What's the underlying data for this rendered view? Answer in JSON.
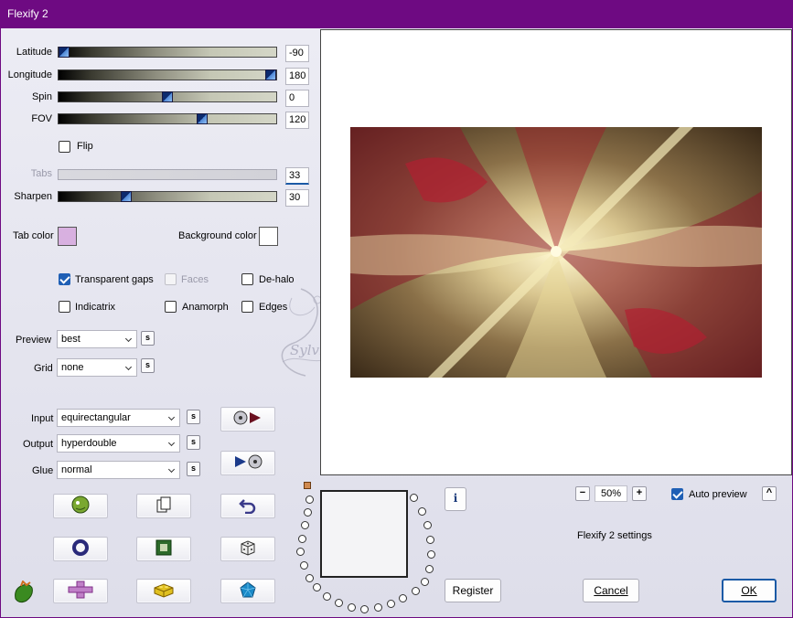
{
  "window": {
    "title": "Flexify 2"
  },
  "params": {
    "latitude": {
      "label": "Latitude",
      "value": "-90",
      "fraction": 0.0
    },
    "longitude": {
      "label": "Longitude",
      "value": "180",
      "fraction": 1.0
    },
    "spin": {
      "label": "Spin",
      "value": "0",
      "fraction": 0.5
    },
    "fov": {
      "label": "FOV",
      "value": "120",
      "fraction": 0.67
    },
    "tabs": {
      "label": "Tabs",
      "value": "33"
    },
    "sharpen": {
      "label": "Sharpen",
      "value": "30",
      "fraction": 0.3
    }
  },
  "flip": {
    "label": "Flip",
    "checked": false
  },
  "tab_color": {
    "label": "Tab color",
    "color": "#d8b0e0"
  },
  "background_color": {
    "label": "Background color",
    "color": "#ffffff"
  },
  "options": {
    "transparent_gaps": {
      "label": "Transparent gaps",
      "checked": true
    },
    "faces": {
      "label": "Faces",
      "checked": false,
      "disabled": true
    },
    "de_halo": {
      "label": "De-halo",
      "checked": false
    },
    "indicatrix": {
      "label": "Indicatrix",
      "checked": false
    },
    "anamorph": {
      "label": "Anamorph",
      "checked": false
    },
    "edges": {
      "label": "Edges",
      "checked": false
    }
  },
  "preview_select": {
    "label": "Preview",
    "value": "best"
  },
  "grid_select": {
    "label": "Grid",
    "value": "none"
  },
  "input_select": {
    "label": "Input",
    "value": "equirectangular"
  },
  "output_select": {
    "label": "Output",
    "value": "hyperdouble"
  },
  "glue_select": {
    "label": "Glue",
    "value": "normal"
  },
  "s_label": "s",
  "zoom": {
    "minus": "−",
    "value": "50%",
    "plus": "+"
  },
  "auto_preview": {
    "label": "Auto preview",
    "checked": true,
    "caret": "^"
  },
  "settings_label": "Flexify 2 settings",
  "info_label": "i",
  "buttons": {
    "register": "Register",
    "cancel": "Cancel",
    "ok": "OK"
  },
  "watermark": "Sylviane",
  "colors": {
    "titlebar": "#6e0a82",
    "accent": "#1f5fb5"
  }
}
